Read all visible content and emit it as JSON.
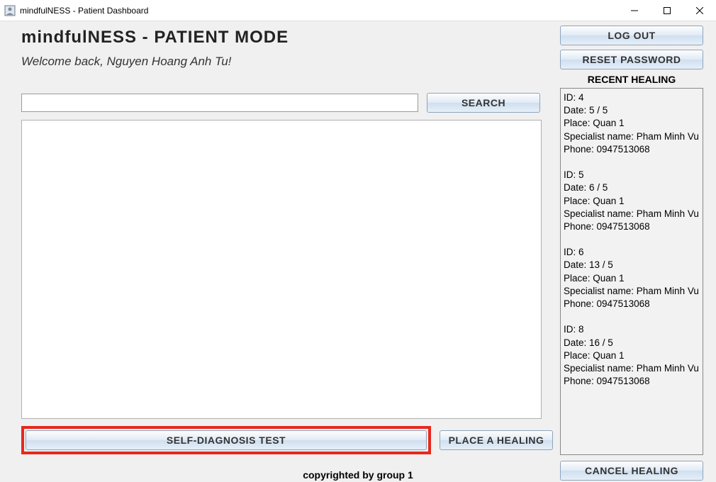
{
  "window": {
    "title": "mindfulNESS - Patient Dashboard"
  },
  "header": {
    "title": "mindfulNESS - PATIENT MODE",
    "welcome": "Welcome back, Nguyen Hoang Anh Tu!"
  },
  "search": {
    "value": "",
    "button_label": "SEARCH"
  },
  "actions": {
    "self_diagnosis": "SELF-DIAGNOSIS TEST",
    "place_healing": "PLACE A HEALING",
    "log_out": "LOG OUT",
    "reset_password": "RESET PASSWORD",
    "cancel_healing": "CANCEL HEALING"
  },
  "recent": {
    "title": "RECENT HEALING",
    "labels": {
      "id": "ID:",
      "date": "Date:",
      "place": "Place:",
      "specialist": "Specialist name:",
      "phone": "Phone:"
    },
    "items": [
      {
        "id": "4",
        "date": "5 / 5",
        "place": "Quan 1",
        "specialist": "Pham Minh Vu",
        "phone": "0947513068"
      },
      {
        "id": "5",
        "date": "6 / 5",
        "place": "Quan 1",
        "specialist": "Pham Minh Vu",
        "phone": "0947513068"
      },
      {
        "id": "6",
        "date": "13 / 5",
        "place": "Quan 1",
        "specialist": "Pham Minh Vu",
        "phone": "0947513068"
      },
      {
        "id": "8",
        "date": "16 / 5",
        "place": "Quan 1",
        "specialist": "Pham Minh Vu",
        "phone": "0947513068"
      }
    ]
  },
  "footer": {
    "text": "copyrighted by group 1"
  }
}
